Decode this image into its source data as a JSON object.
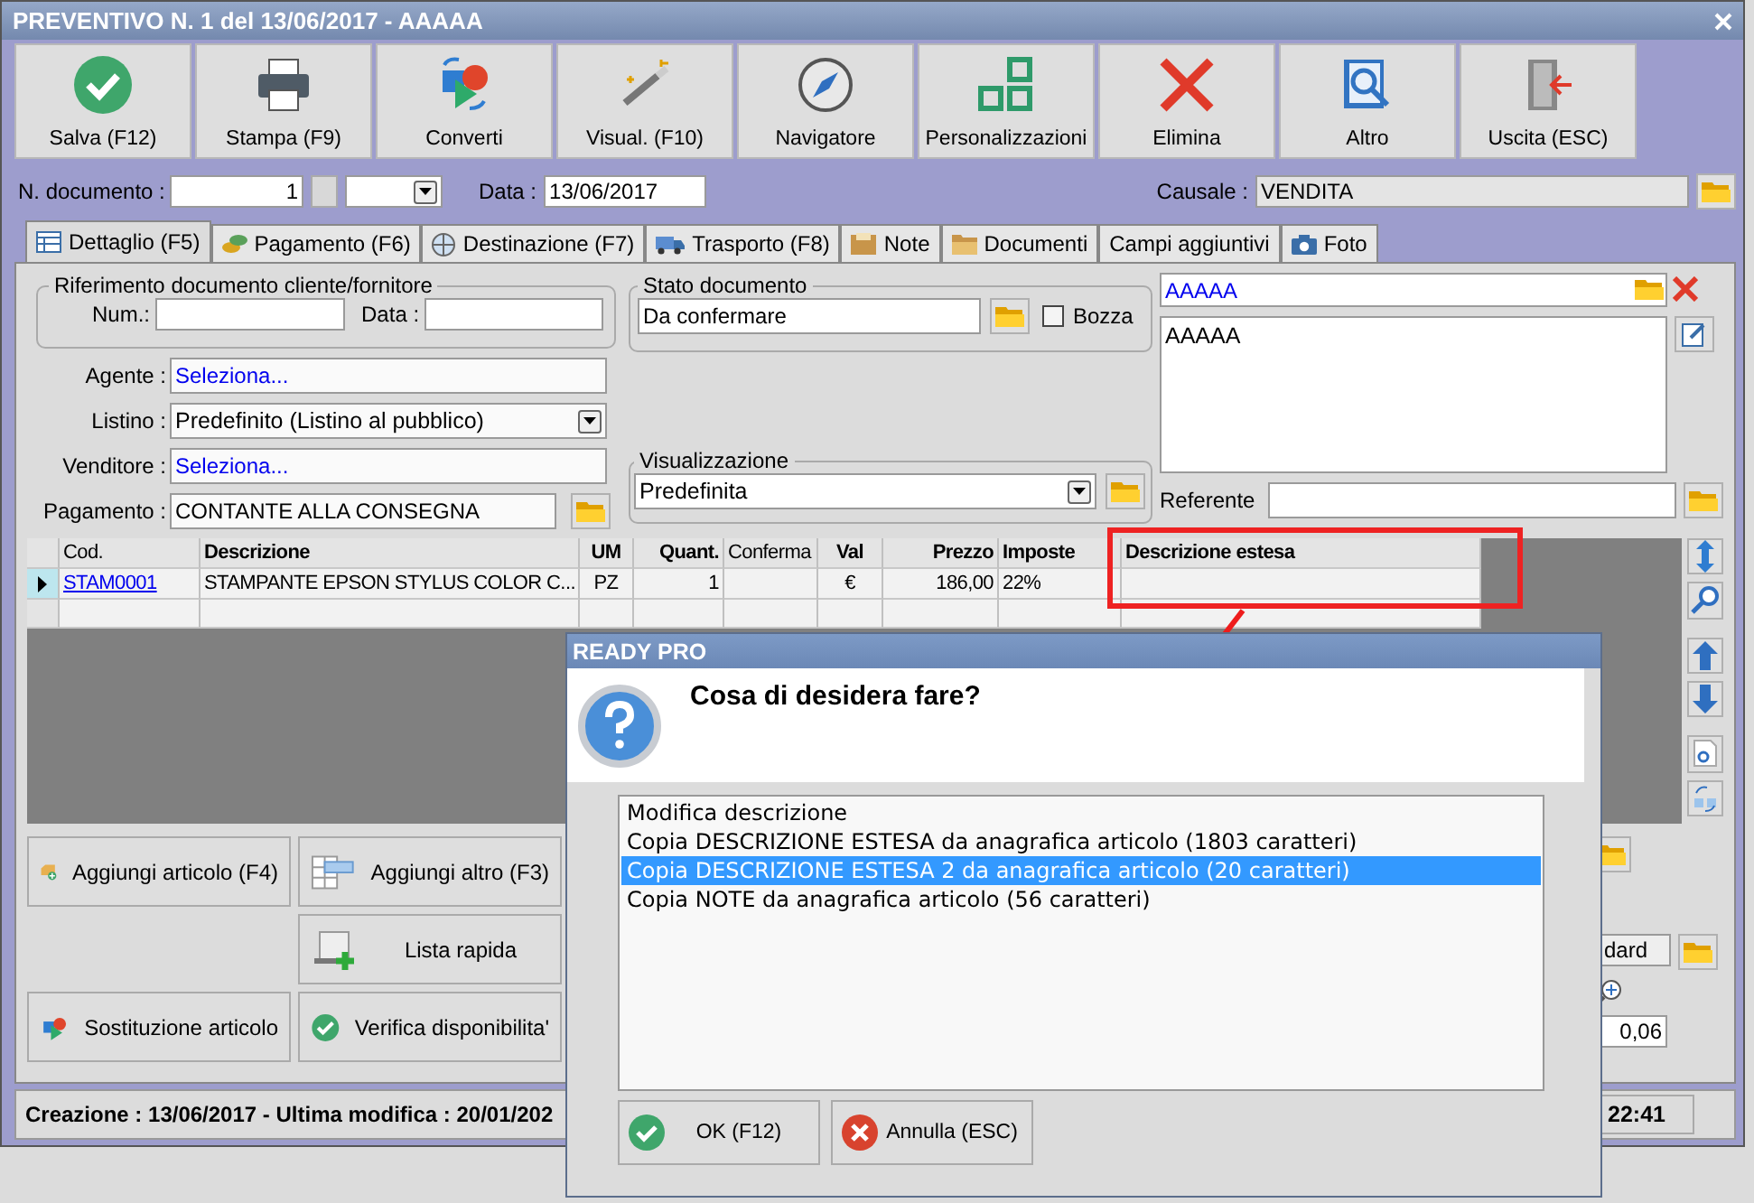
{
  "window": {
    "title": "PREVENTIVO N. 1 del 13/06/2017 - AAAAA"
  },
  "toolbar": [
    {
      "label": "Salva (F12)"
    },
    {
      "label": "Stampa (F9)"
    },
    {
      "label": "Converti"
    },
    {
      "label": "Visual. (F10)"
    },
    {
      "label": "Navigatore"
    },
    {
      "label": "Personalizzazioni"
    },
    {
      "label": "Elimina"
    },
    {
      "label": "Altro"
    },
    {
      "label": "Uscita (ESC)"
    }
  ],
  "header": {
    "doc_number_label": "N. documento :",
    "doc_number": "1",
    "date_label": "Data :",
    "date": "13/06/2017",
    "causale_label": "Causale :",
    "causale": "VENDITA"
  },
  "tabs": [
    {
      "label": "Dettaglio (F5)",
      "selected": true
    },
    {
      "label": "Pagamento (F6)",
      "selected": false
    },
    {
      "label": "Destinazione (F7)",
      "selected": false
    },
    {
      "label": "Trasporto (F8)",
      "selected": false
    },
    {
      "label": "Note",
      "selected": false
    },
    {
      "label": "Documenti",
      "selected": false
    },
    {
      "label": "Campi aggiuntivi",
      "selected": false
    },
    {
      "label": "Foto",
      "selected": false
    }
  ],
  "riferimento": {
    "legend": "Riferimento documento cliente/fornitore",
    "num_label": "Num.:",
    "data_label": "Data :"
  },
  "form": [
    {
      "label": "Agente :",
      "value": "Seleziona...",
      "kind": "link"
    },
    {
      "label": "Listino :",
      "value": "Predefinito (Listino al pubblico)",
      "kind": "select"
    },
    {
      "label": "Venditore :",
      "value": "Seleziona...",
      "kind": "link"
    },
    {
      "label": "Pagamento :",
      "value": "CONTANTE ALLA CONSEGNA",
      "kind": "lookup"
    }
  ],
  "stato": {
    "legend": "Stato documento",
    "value": "Da confermare",
    "bozza": {
      "label": "Bozza",
      "checked": false
    }
  },
  "visualizzazione": {
    "legend": "Visualizzazione",
    "value": "Predefinita"
  },
  "cliente": {
    "name": "AAAAA",
    "address": "AAAAA",
    "referente_label": "Referente"
  },
  "table": {
    "columns": [
      "Cod.",
      "Descrizione",
      "UM",
      "Quant.",
      "Conferma",
      "Val",
      "Prezzo",
      "Imposte",
      "Descrizione estesa"
    ],
    "rows": [
      {
        "current": true,
        "cells": [
          "STAM0001",
          "STAMPANTE EPSON STYLUS COLOR C...",
          "PZ",
          "1",
          null,
          "€",
          "186,00",
          "22%",
          null
        ]
      }
    ]
  },
  "bottom_buttons": [
    {
      "label": "Aggiungi articolo (F4)"
    },
    {
      "label": "Aggiungi altro (F3)"
    },
    {
      "label": "Lista rapida"
    },
    {
      "label": "Sostituzione articolo"
    },
    {
      "label": "Verifica disponibilita'"
    }
  ],
  "partial_fields": [
    "dard",
    "0,06"
  ],
  "status_bar": {
    "info": "Creazione : 13/06/2017 - Ultima modifica : 20/01/202",
    "time": "22:41"
  },
  "dialog": {
    "title": "READY PRO",
    "question": "Cosa di desidera fare?",
    "options": [
      {
        "label": "Modifica descrizione",
        "selected": false
      },
      {
        "label": "Copia DESCRIZIONE ESTESA da anagrafica articolo (1803 caratteri)",
        "selected": false
      },
      {
        "label": "Copia DESCRIZIONE ESTESA 2 da anagrafica articolo (20 caratteri)",
        "selected": true
      },
      {
        "label": "Copia NOTE da anagrafica articolo (56 caratteri)",
        "selected": false
      }
    ],
    "buttons": [
      {
        "label": "OK (F12)"
      },
      {
        "label": "Annulla (ESC)"
      }
    ]
  }
}
